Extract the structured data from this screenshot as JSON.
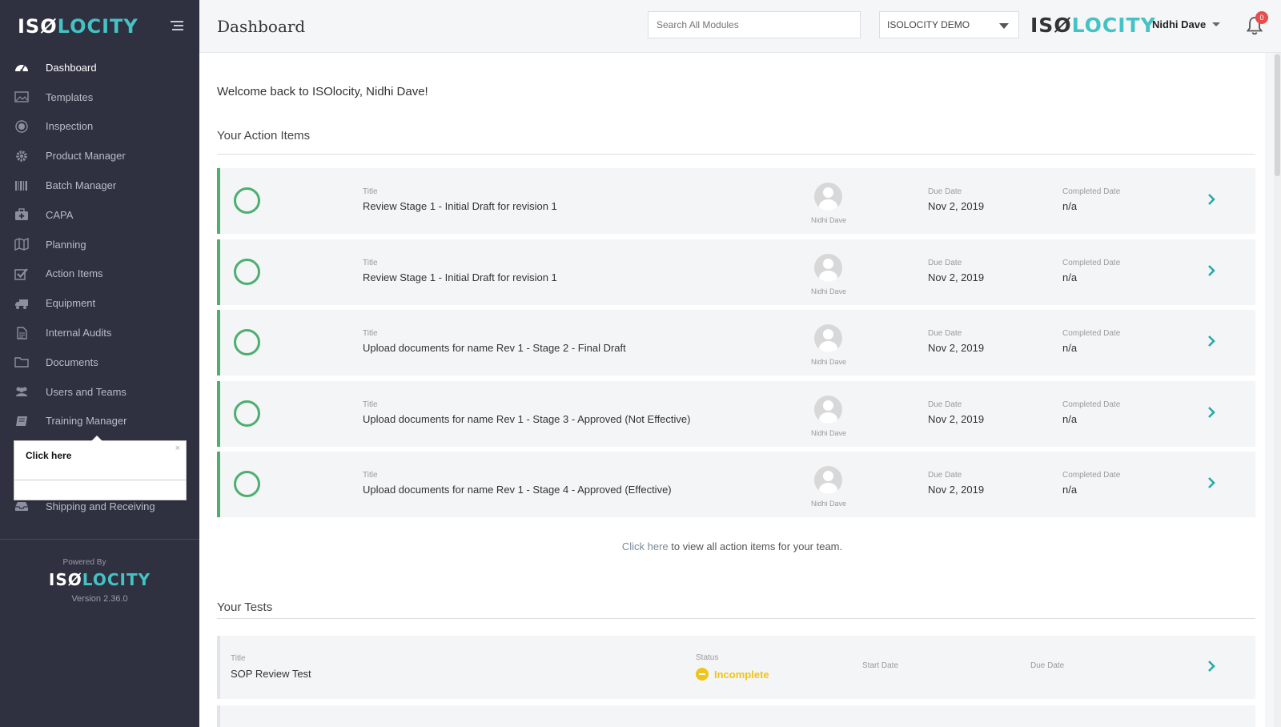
{
  "app": {
    "logo_iso": "IS",
    "logo_o": "Ø",
    "logo_ocity": "LOCITY"
  },
  "sidebar": {
    "items": [
      {
        "label": "Dashboard",
        "icon": "dashboard-icon",
        "active": true
      },
      {
        "label": "Templates",
        "icon": "image-icon",
        "active": false
      },
      {
        "label": "Inspection",
        "icon": "target-icon",
        "active": false
      },
      {
        "label": "Product Manager",
        "icon": "gear-icon",
        "active": false
      },
      {
        "label": "Batch Manager",
        "icon": "barcode-icon",
        "active": false
      },
      {
        "label": "CAPA",
        "icon": "medkit-icon",
        "active": false
      },
      {
        "label": "Planning",
        "icon": "map-icon",
        "active": false
      },
      {
        "label": "Action Items",
        "icon": "checkbox-icon",
        "active": false
      },
      {
        "label": "Equipment",
        "icon": "truck-icon",
        "active": false
      },
      {
        "label": "Internal Audits",
        "icon": "document-icon",
        "active": false
      },
      {
        "label": "Documents",
        "icon": "folder-icon",
        "active": false
      },
      {
        "label": "Users and Teams",
        "icon": "users-icon",
        "active": false
      },
      {
        "label": "Training Manager",
        "icon": "book-icon",
        "active": false
      }
    ],
    "shipping_label": "Shipping and Receiving",
    "tooltip": {
      "title": "Click here",
      "close": "×"
    },
    "footer": {
      "powered_by": "Powered By",
      "version": "Version 2.36.0"
    }
  },
  "topbar": {
    "page_title": "Dashboard",
    "search_placeholder": "Search All Modules",
    "org_selected": "ISOLOCITY DEMO",
    "user_name": "Nidhi Dave",
    "notification_count": "0"
  },
  "main": {
    "welcome": "Welcome back to ISOlocity, Nidhi Dave!",
    "action_items_title": "Your Action Items",
    "labels": {
      "title": "Title",
      "due_date": "Due Date",
      "completed_date": "Completed Date",
      "status": "Status",
      "start_date": "Start Date"
    },
    "action_items": [
      {
        "title": "Review Stage 1 - Initial Draft for revision 1",
        "assignee": "Nidhi Dave",
        "due": "Nov 2, 2019",
        "completed": "n/a"
      },
      {
        "title": "Review Stage 1 - Initial Draft for revision 1",
        "assignee": "Nidhi Dave",
        "due": "Nov 2, 2019",
        "completed": "n/a"
      },
      {
        "title": "Upload documents for name Rev 1 - Stage 2 - Final Draft",
        "assignee": "Nidhi Dave",
        "due": "Nov 2, 2019",
        "completed": "n/a"
      },
      {
        "title": "Upload documents for name Rev 1 - Stage 3 - Approved (Not Effective)",
        "assignee": "Nidhi Dave",
        "due": "Nov 2, 2019",
        "completed": "n/a"
      },
      {
        "title": "Upload documents for name Rev 1 - Stage 4 - Approved (Effective)",
        "assignee": "Nidhi Dave",
        "due": "Nov 2, 2019",
        "completed": "n/a"
      }
    ],
    "team_link": {
      "link_text": "Click here",
      "rest": " to view all action items for your team."
    },
    "tests_title": "Your Tests",
    "tests": [
      {
        "title": "SOP Review Test",
        "status": "Incomplete"
      }
    ]
  },
  "colors": {
    "sidebar_bg": "#2f3140",
    "accent_teal": "#44c3c4",
    "action_green": "#4caf6e",
    "incomplete_yellow": "#f0c419",
    "badge_red": "#e84c4c"
  }
}
